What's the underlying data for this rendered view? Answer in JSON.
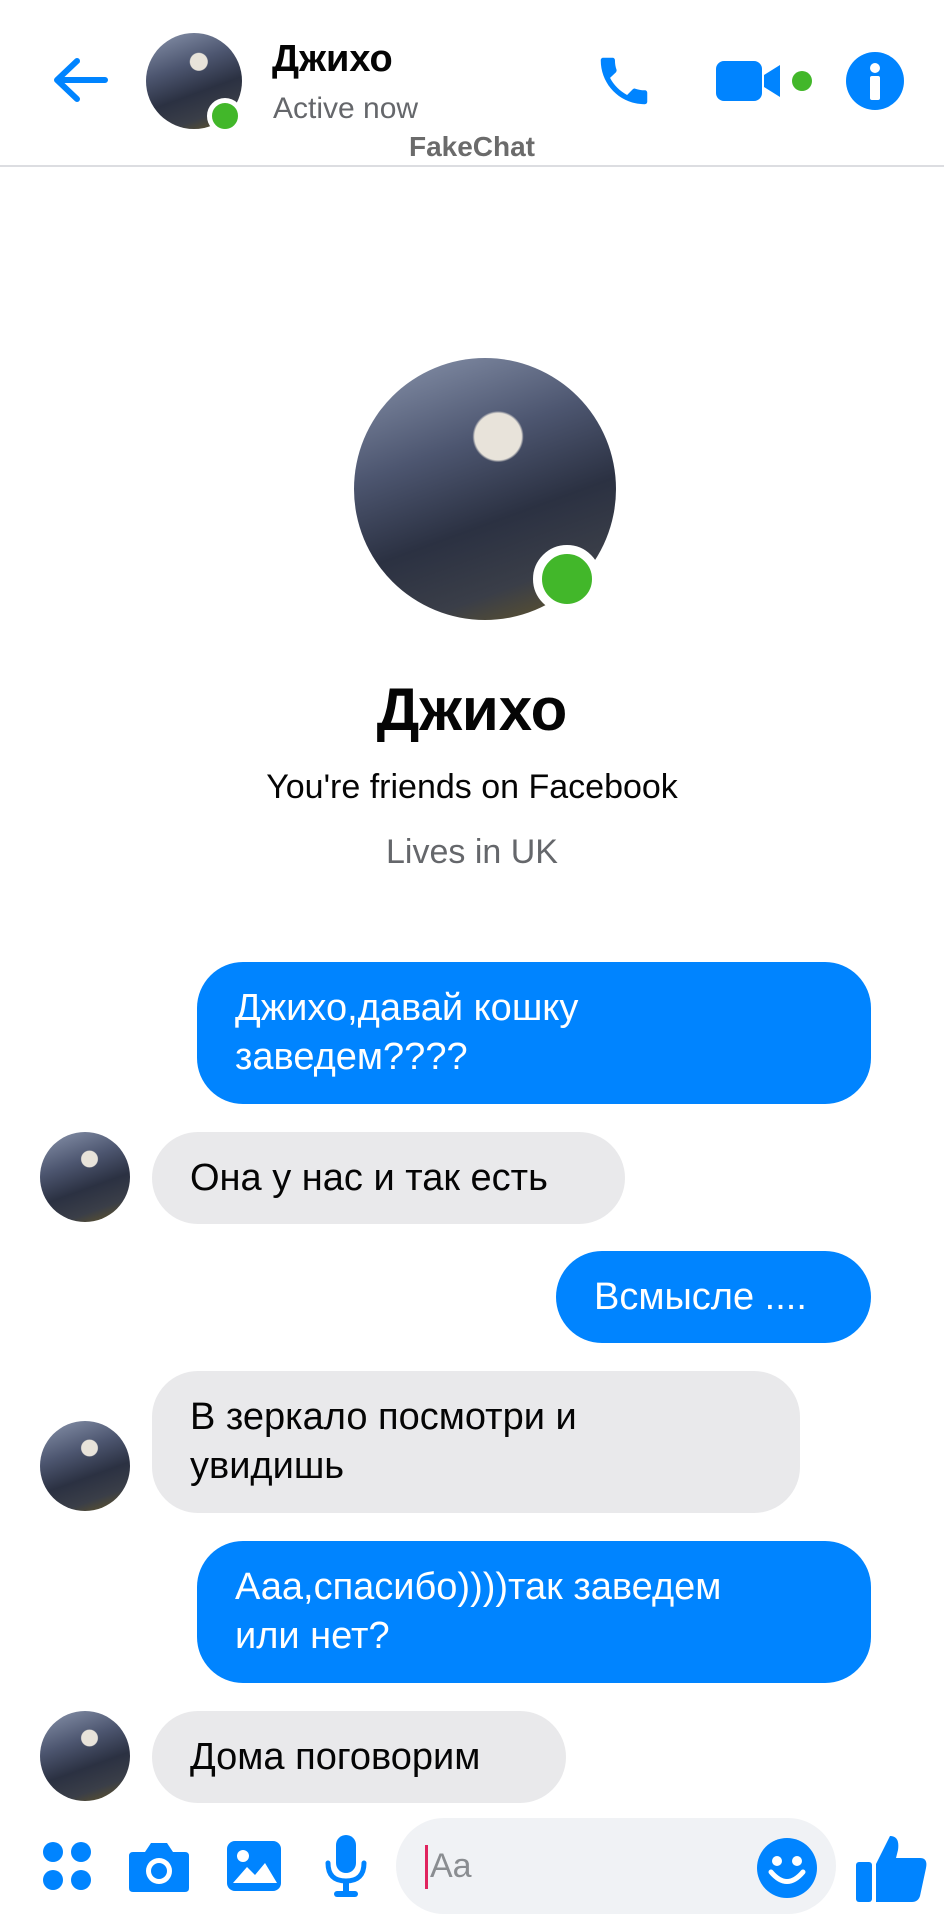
{
  "header": {
    "contact_name": "Джихо",
    "status": "Active now",
    "watermark": "FakeChat"
  },
  "profile": {
    "name": "Джихо",
    "friends_text": "You're friends on Facebook",
    "location": "Lives in UK"
  },
  "messages": [
    {
      "direction": "outgoing",
      "text": "Джихо,давай кошку\nзаведем????"
    },
    {
      "direction": "incoming",
      "text": "Она у нас и так есть"
    },
    {
      "direction": "outgoing",
      "text": "Всмысле ...."
    },
    {
      "direction": "incoming",
      "text": "В зеркало посмотри и\nувидишь"
    },
    {
      "direction": "outgoing",
      "text": "Ааа,спасибо))))так заведем\nили нет?"
    },
    {
      "direction": "incoming",
      "text": "Дома поговорим"
    }
  ],
  "composer": {
    "placeholder": "Aa"
  },
  "icons": {
    "back": "arrow-left-icon",
    "call": "phone-icon",
    "video": "video-camera-icon",
    "info": "info-icon",
    "apps": "apps-grid-icon",
    "camera": "camera-icon",
    "gallery": "image-icon",
    "mic": "microphone-icon",
    "emoji": "smiley-icon",
    "like": "thumbs-up-icon"
  },
  "colors": {
    "accent": "#0084ff",
    "online": "#42b72a",
    "incoming_bubble": "#e9e9eb"
  }
}
